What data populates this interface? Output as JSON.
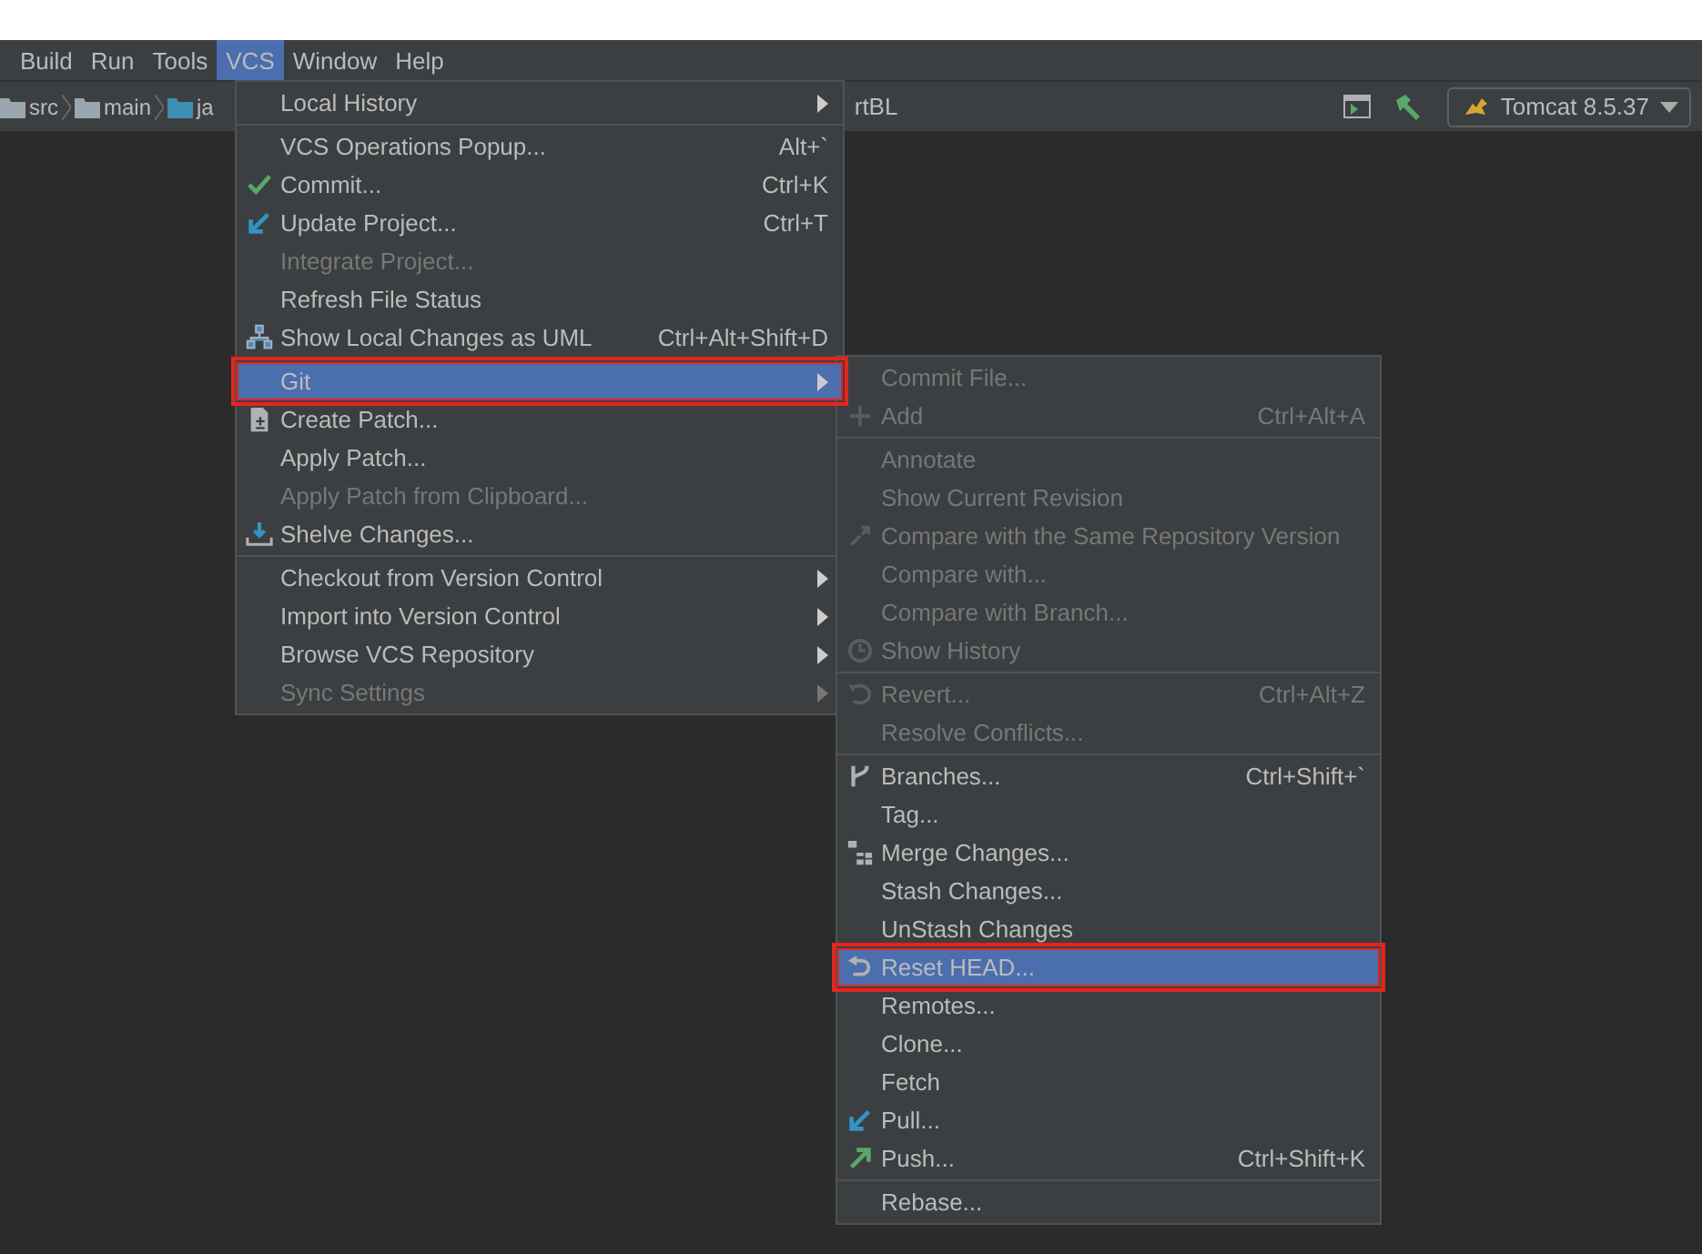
{
  "menu_bar": [
    {
      "label": "Build",
      "selected": false
    },
    {
      "label": "Run",
      "selected": false
    },
    {
      "label": "Tools",
      "selected": false
    },
    {
      "label": "VCS",
      "selected": true
    },
    {
      "label": "Window",
      "selected": false
    },
    {
      "label": "Help",
      "selected": false
    }
  ],
  "breadcrumbs": [
    {
      "label": "src"
    },
    {
      "label": "main"
    },
    {
      "label": "ja"
    }
  ],
  "breadcrumb_tail": "rtBL",
  "run_config": {
    "label": "Tomcat 8.5.37"
  },
  "vcs_menu": {
    "groups": [
      [
        {
          "label": "Local History",
          "submenu": true,
          "disabled": false,
          "selected": false,
          "highlighted": false
        }
      ],
      [
        {
          "label": "VCS Operations Popup...",
          "shortcut": "Alt+`",
          "submenu": false,
          "disabled": false,
          "selected": false,
          "highlighted": false
        },
        {
          "label": "Commit...",
          "shortcut": "Ctrl+K",
          "submenu": false,
          "disabled": false,
          "selected": false,
          "highlighted": false
        },
        {
          "label": "Update Project...",
          "shortcut": "Ctrl+T",
          "submenu": false,
          "disabled": false,
          "selected": false,
          "highlighted": false
        },
        {
          "label": "Integrate Project...",
          "submenu": false,
          "disabled": true,
          "selected": false,
          "highlighted": false
        },
        {
          "label": "Refresh File Status",
          "submenu": false,
          "disabled": false,
          "selected": false,
          "highlighted": false
        },
        {
          "label": "Show Local Changes as UML",
          "shortcut": "Ctrl+Alt+Shift+D",
          "submenu": false,
          "disabled": false,
          "selected": false,
          "highlighted": false
        }
      ],
      [
        {
          "label": "Git",
          "submenu": true,
          "disabled": false,
          "selected": true,
          "highlighted": true
        },
        {
          "label": "Create Patch...",
          "submenu": false,
          "disabled": false,
          "selected": false,
          "highlighted": false
        },
        {
          "label": "Apply Patch...",
          "submenu": false,
          "disabled": false,
          "selected": false,
          "highlighted": false
        },
        {
          "label": "Apply Patch from Clipboard...",
          "submenu": false,
          "disabled": true,
          "selected": false,
          "highlighted": false
        },
        {
          "label": "Shelve Changes...",
          "submenu": false,
          "disabled": false,
          "selected": false,
          "highlighted": false
        }
      ],
      [
        {
          "label": "Checkout from Version Control",
          "submenu": true,
          "disabled": false,
          "selected": false,
          "highlighted": false
        },
        {
          "label": "Import into Version Control",
          "submenu": true,
          "disabled": false,
          "selected": false,
          "highlighted": false
        },
        {
          "label": "Browse VCS Repository",
          "submenu": true,
          "disabled": false,
          "selected": false,
          "highlighted": false
        },
        {
          "label": "Sync Settings",
          "submenu": true,
          "disabled": true,
          "selected": false,
          "highlighted": false
        }
      ]
    ]
  },
  "git_menu": {
    "groups": [
      [
        {
          "label": "Commit File...",
          "submenu": false,
          "disabled": true,
          "selected": false,
          "highlighted": false
        },
        {
          "label": "Add",
          "shortcut": "Ctrl+Alt+A",
          "submenu": false,
          "disabled": true,
          "selected": false,
          "highlighted": false
        }
      ],
      [
        {
          "label": "Annotate",
          "submenu": false,
          "disabled": true,
          "selected": false,
          "highlighted": false
        },
        {
          "label": "Show Current Revision",
          "submenu": false,
          "disabled": true,
          "selected": false,
          "highlighted": false
        },
        {
          "label": "Compare with the Same Repository Version",
          "submenu": false,
          "disabled": true,
          "selected": false,
          "highlighted": false
        },
        {
          "label": "Compare with...",
          "submenu": false,
          "disabled": true,
          "selected": false,
          "highlighted": false
        },
        {
          "label": "Compare with Branch...",
          "submenu": false,
          "disabled": true,
          "selected": false,
          "highlighted": false
        },
        {
          "label": "Show History",
          "submenu": false,
          "disabled": true,
          "selected": false,
          "highlighted": false
        }
      ],
      [
        {
          "label": "Revert...",
          "shortcut": "Ctrl+Alt+Z",
          "submenu": false,
          "disabled": true,
          "selected": false,
          "highlighted": false
        },
        {
          "label": "Resolve Conflicts...",
          "submenu": false,
          "disabled": true,
          "selected": false,
          "highlighted": false
        }
      ],
      [
        {
          "label": "Branches...",
          "shortcut": "Ctrl+Shift+`",
          "submenu": false,
          "disabled": false,
          "selected": false,
          "highlighted": false
        },
        {
          "label": "Tag...",
          "submenu": false,
          "disabled": false,
          "selected": false,
          "highlighted": false
        },
        {
          "label": "Merge Changes...",
          "submenu": false,
          "disabled": false,
          "selected": false,
          "highlighted": false
        },
        {
          "label": "Stash Changes...",
          "submenu": false,
          "disabled": false,
          "selected": false,
          "highlighted": false
        },
        {
          "label": "UnStash Changes",
          "submenu": false,
          "disabled": false,
          "selected": false,
          "highlighted": false
        },
        {
          "label": "Reset HEAD...",
          "submenu": false,
          "disabled": false,
          "selected": true,
          "highlighted": true
        },
        {
          "label": "Remotes...",
          "submenu": false,
          "disabled": false,
          "selected": false,
          "highlighted": false
        },
        {
          "label": "Clone...",
          "submenu": false,
          "disabled": false,
          "selected": false,
          "highlighted": false
        },
        {
          "label": "Fetch",
          "submenu": false,
          "disabled": false,
          "selected": false,
          "highlighted": false
        },
        {
          "label": "Pull...",
          "submenu": false,
          "disabled": false,
          "selected": false,
          "highlighted": false
        },
        {
          "label": "Push...",
          "shortcut": "Ctrl+Shift+K",
          "submenu": false,
          "disabled": false,
          "selected": false,
          "highlighted": false
        }
      ],
      [
        {
          "label": "Rebase...",
          "submenu": false,
          "disabled": false,
          "selected": false,
          "highlighted": false
        }
      ]
    ]
  }
}
